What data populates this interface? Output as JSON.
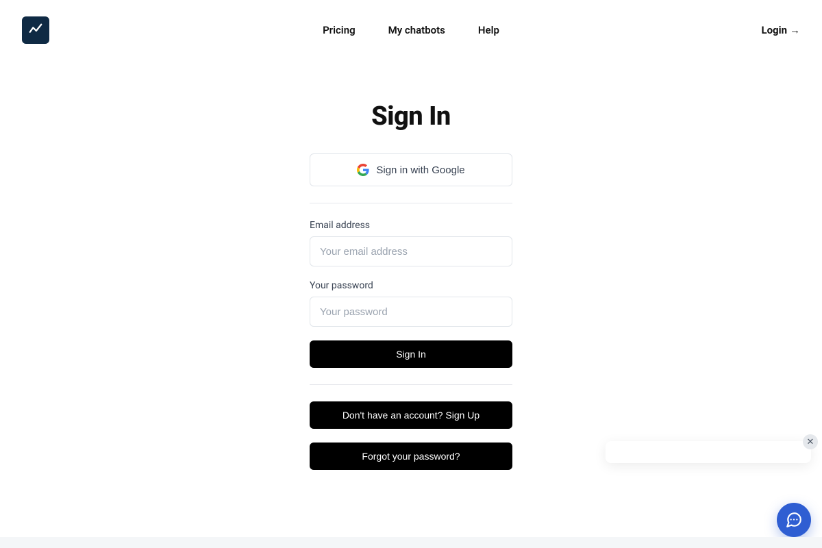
{
  "nav": {
    "items": [
      "Pricing",
      "My chatbots",
      "Help"
    ],
    "login_label": "Login",
    "login_arrow": "→"
  },
  "signin": {
    "title": "Sign In",
    "google_label": "Sign in with Google",
    "email": {
      "label": "Email address",
      "placeholder": "Your email address",
      "value": ""
    },
    "password": {
      "label": "Your password",
      "placeholder": "Your password",
      "value": ""
    },
    "submit_label": "Sign In",
    "signup_label": "Don't have an account? Sign Up",
    "forgot_label": "Forgot your password?"
  },
  "chat": {
    "close_glyph": "✕"
  }
}
